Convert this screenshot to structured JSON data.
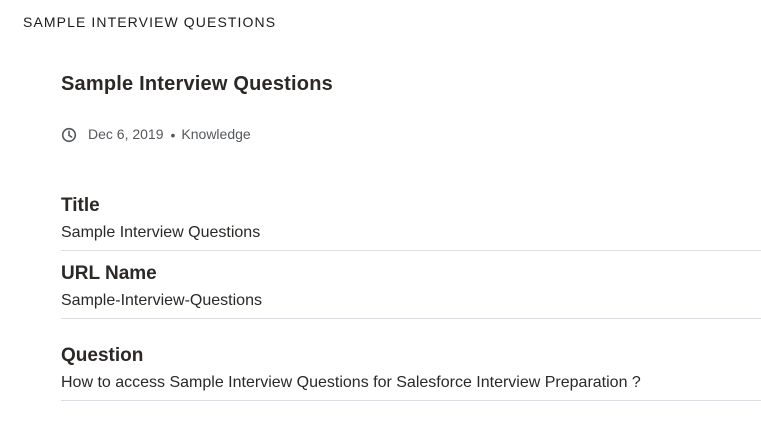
{
  "header": {
    "section_title": "SAMPLE INTERVIEW QUESTIONS"
  },
  "article": {
    "title": "Sample Interview Questions",
    "meta": {
      "icon": "clock-icon",
      "date": "Dec 6, 2019",
      "separator": "•",
      "category": "Knowledge"
    },
    "fields": [
      {
        "label": "Title",
        "value": "Sample Interview Questions"
      },
      {
        "label": "URL Name",
        "value": "Sample-Interview-Questions"
      },
      {
        "label": "Question",
        "value": "How to access Sample Interview Questions for Salesforce Interview Preparation ?"
      }
    ]
  }
}
